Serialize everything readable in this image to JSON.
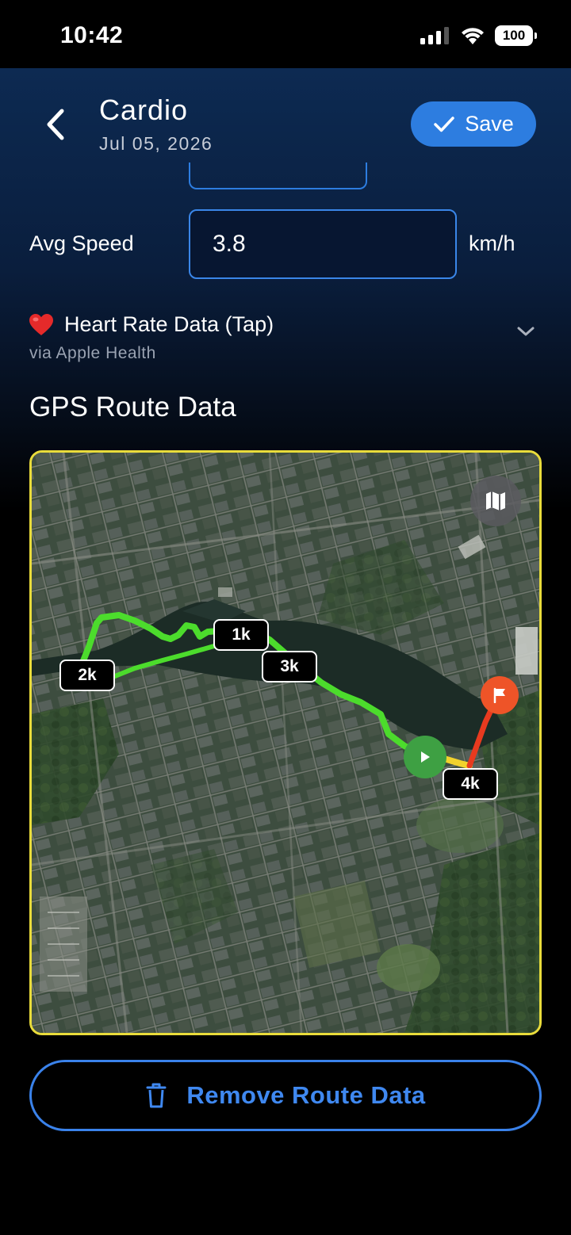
{
  "status_bar": {
    "time": "10:42",
    "battery": "100"
  },
  "header": {
    "title": "Cardio",
    "date": "Jul 05, 2026",
    "save_label": "Save"
  },
  "avg_speed": {
    "label": "Avg Speed",
    "value": "3.8",
    "unit": "km/h"
  },
  "heart_rate": {
    "title": "Heart Rate Data (Tap)",
    "source": "via Apple Health"
  },
  "gps": {
    "section_title": "GPS Route Data",
    "km_markers": [
      "1k",
      "2k",
      "3k",
      "4k"
    ],
    "remove_label": "Remove Route Data"
  },
  "colors": {
    "accent": "#2d7de0",
    "route": "#4cdc2c",
    "map_border": "#e9dc3b",
    "start": "#3ea043",
    "finish": "#ee5428"
  }
}
